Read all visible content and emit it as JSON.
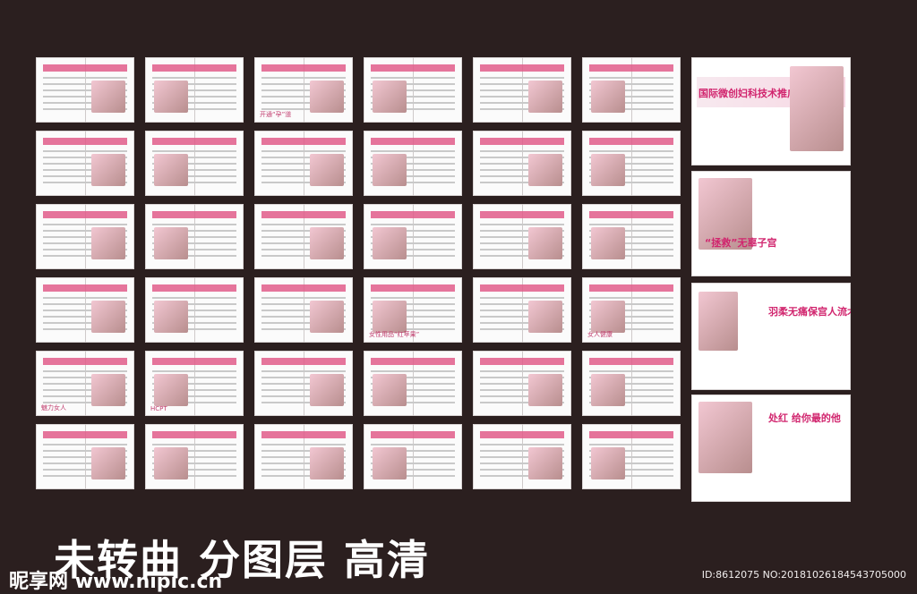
{
  "bottom_title": "未转曲  分图层  高清",
  "watermark": "昵享网 www.nipic.cn",
  "image_id": "ID:8612075 NO:20181026184543705000",
  "hero_cards": [
    {
      "heading": "国际微创妇科技术推广"
    },
    {
      "heading": "“拯救”无辜子宫"
    },
    {
      "heading": "羽柔无痛保宫人流术"
    },
    {
      "heading": "处红 给你最的他"
    }
  ],
  "spread_caps": [
    "",
    "",
    "开通“孕”道",
    "",
    "",
    "",
    "",
    "",
    "",
    "",
    "",
    "",
    "",
    "",
    "",
    "",
    "",
    "",
    "",
    "",
    "",
    "女性用品“红苹果”",
    "",
    "女人健康",
    "魅力女人",
    "HCPT",
    "",
    "",
    "",
    "",
    "",
    "",
    "",
    "",
    "",
    "",
    "",
    "",
    "",
    "",
    "",
    ""
  ]
}
